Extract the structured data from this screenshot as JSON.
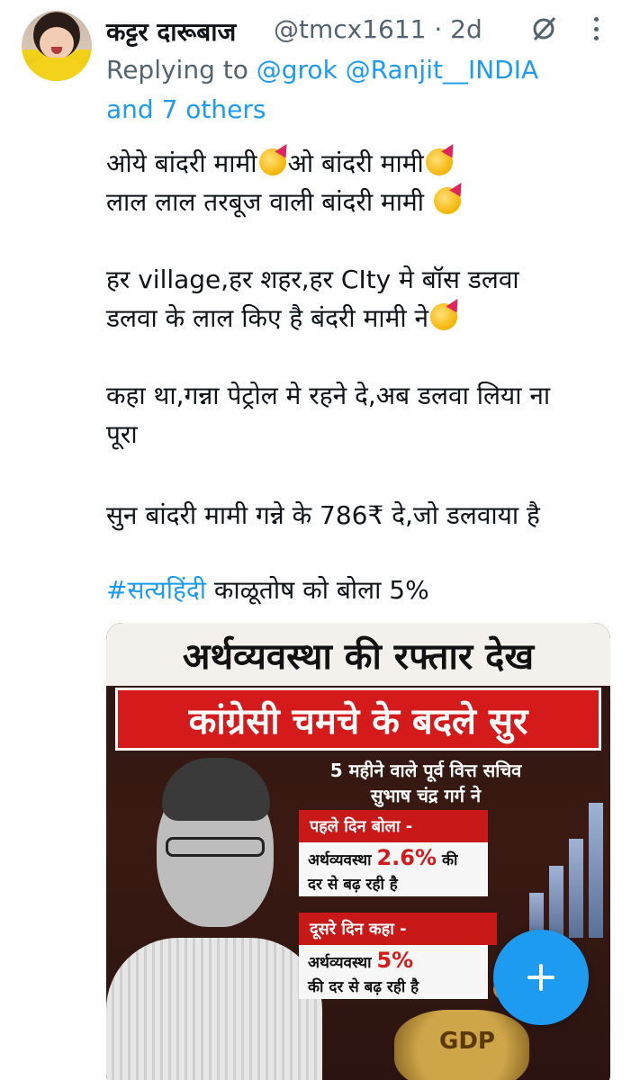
{
  "tweet": {
    "display_name": "कट्टर दारूबाज",
    "handle": "@tmcx1611 · 2d",
    "replying_prefix": "Replying to",
    "replying_mentions": "@grok @Ranjit__INDIA",
    "replying_suffix": "and 7 others",
    "lines": {
      "l1": "ओये बांदरी मामी",
      "l1b": "ओ बांदरी मामी",
      "l2": "लाल लाल तरबूज वाली बांदरी मामी",
      "l3": "हर village,हर शहर,हर CIty मे बॉस डलवा",
      "l4": "डलवा के लाल किए है बंदरी मामी ने",
      "l5": "कहा था,गन्ना पेट्रोल मे रहने दे,अब डलवा लिया ना",
      "l6": "पूरा",
      "l7": "सुन बांदरी मामी गन्ने के 786₹ दे,जो डलवाया है",
      "hashtag": "#सत्यहिंदी",
      "l8": " काळूतोष को बोला 5%"
    }
  },
  "media": {
    "banner_top": "अर्थव्यवस्था की रफ्तार देख",
    "banner_red": "कांग्रेसी चमचे के बदले सुर",
    "subhead_1": "5 महीने वाले पूर्व वित्त सचिव",
    "subhead_2": "सुभाष चंद्र गर्ग ने",
    "box1_head": "पहले दिन बोला -",
    "box1_a": "अर्थव्यवस्था",
    "box1_num": "2.6%",
    "box1_b": "की",
    "box1_c": "दर से बढ़ रही है",
    "box2_head": "दूसरे दिन कहा -",
    "box2_a": "अर्थव्यवस्था",
    "box2_num": "5%",
    "box2_c": "की दर से बढ़ रही है",
    "gdp": "GDP"
  },
  "icons": {
    "grok": "grok-icon",
    "more": "more-icon",
    "compose": "compose-plus-icon"
  },
  "colors": {
    "accent": "#1d9bf0",
    "secondary_text": "#536471"
  }
}
